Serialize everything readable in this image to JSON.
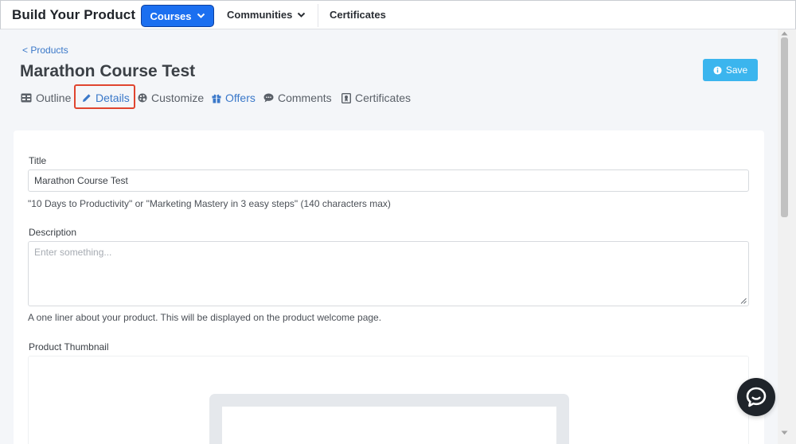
{
  "brand": "Build Your Product",
  "nav": {
    "courses": "Courses",
    "communities": "Communities",
    "certificates": "Certificates"
  },
  "breadcrumb": "< Products",
  "page_title": "Marathon Course Test",
  "save_label": "Save",
  "tabs": [
    {
      "label": "Outline",
      "icon": "outline-icon"
    },
    {
      "label": "Details",
      "icon": "pencil-icon",
      "active": true
    },
    {
      "label": "Customize",
      "icon": "palette-icon"
    },
    {
      "label": "Offers",
      "icon": "gift-icon"
    },
    {
      "label": "Comments",
      "icon": "comment-icon"
    },
    {
      "label": "Certificates",
      "icon": "certificate-icon"
    }
  ],
  "form": {
    "title_label": "Title",
    "title_value": "Marathon Course Test",
    "title_hint": "\"10 Days to Productivity\" or \"Marketing Mastery in 3 easy steps\" (140 characters max)",
    "description_label": "Description",
    "description_placeholder": "Enter something...",
    "description_hint": "A one liner about your product. This will be displayed on the product welcome page.",
    "thumbnail_label": "Product Thumbnail"
  },
  "colors": {
    "primary": "#1b6ff0",
    "save": "#3bb5ee",
    "link": "#3a78c9",
    "highlight": "#e0452f"
  }
}
